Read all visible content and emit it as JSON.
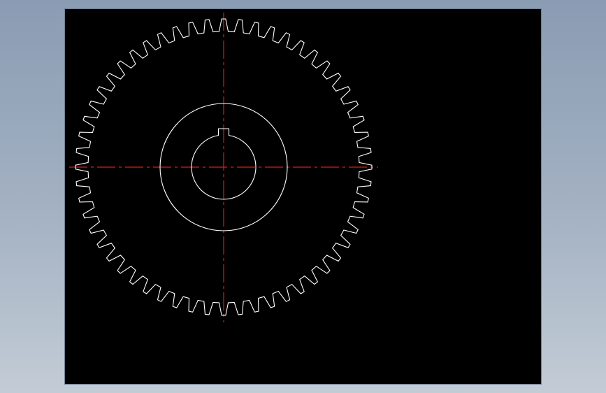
{
  "drawing": {
    "subject": "spur-gear-front-view",
    "tooth_count": 56,
    "background_color": "#000000",
    "outline_color": "#ffffff",
    "centerline_color": "#dd1c1c",
    "backdrop_top_color": "#8a9cb3",
    "backdrop_bottom_color": "#c3ccd6"
  }
}
